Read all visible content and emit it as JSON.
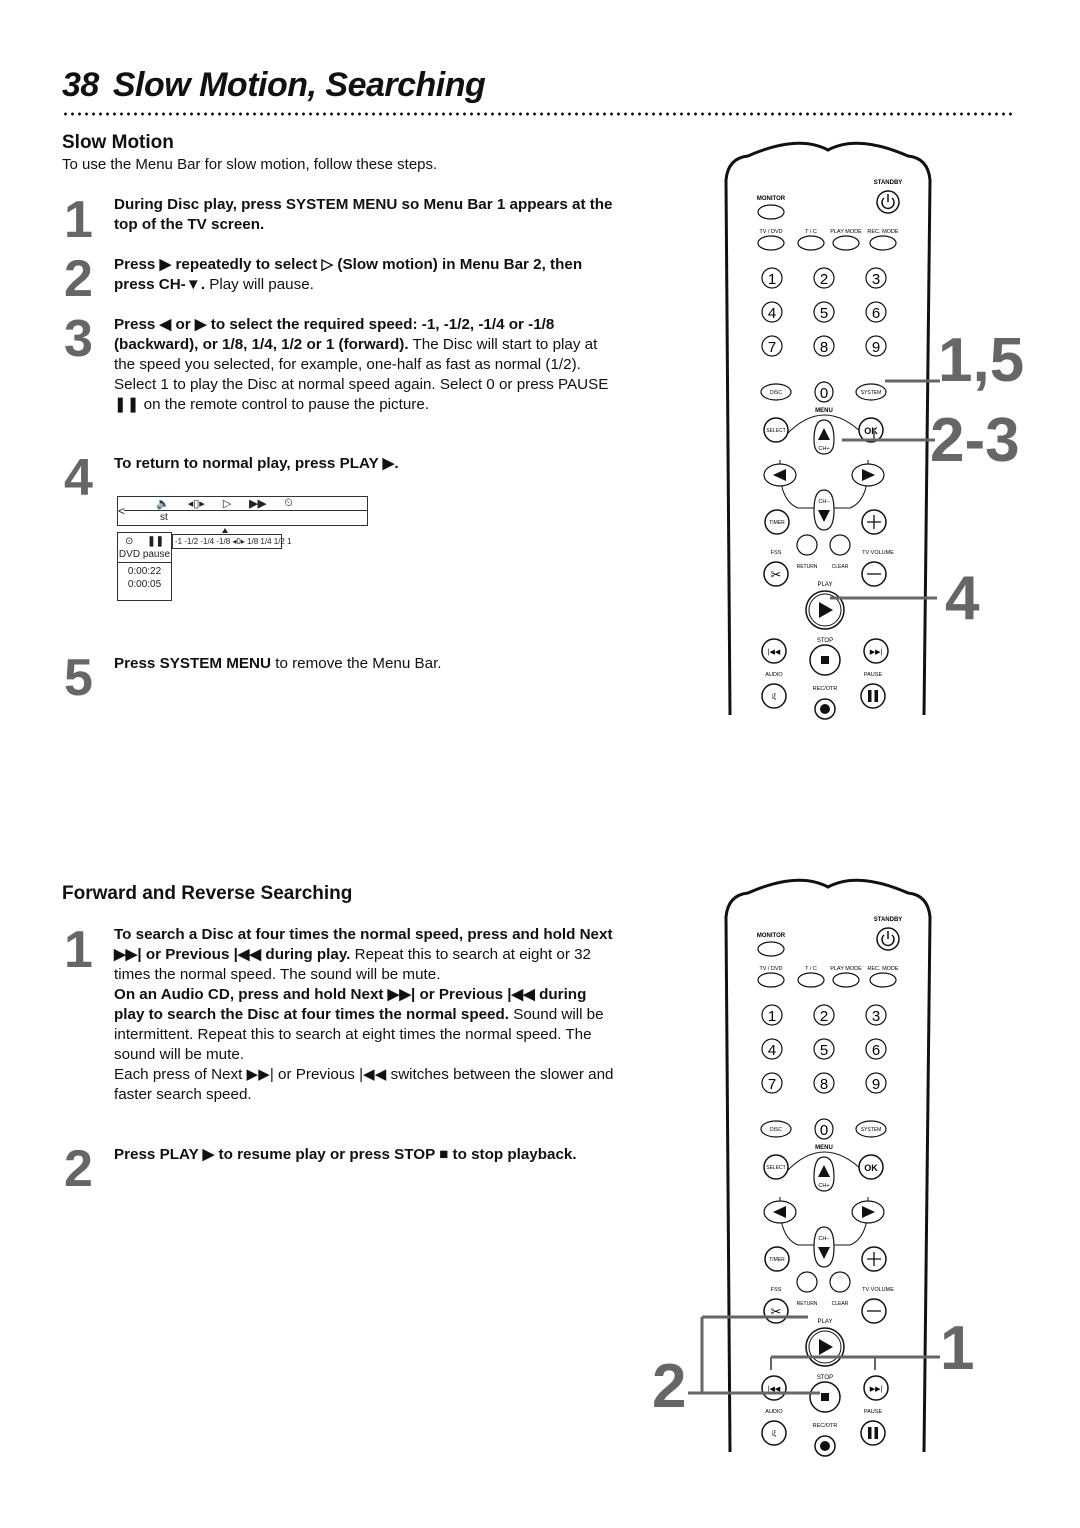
{
  "page": {
    "number": "38",
    "title": "Slow Motion, Searching"
  },
  "slow_motion": {
    "heading": "Slow Motion",
    "intro": "To use the Menu Bar for slow motion, follow these steps.",
    "steps": [
      {
        "num": "1",
        "bold": "During Disc play, press SYSTEM MENU so Menu Bar 1 appears at the top of the TV screen.",
        "normal": ""
      },
      {
        "num": "2",
        "bold": "Press ▶ repeatedly to select ▷ (Slow motion) in Menu Bar 2, then press CH-▼.",
        "normal": " Play will pause."
      },
      {
        "num": "3",
        "bold": "Press ◀ or ▶ to select the required speed: -1, -1/2, -1/4 or -1/8 (backward), or 1/8, 1/4, 1/2 or 1 (forward).",
        "normal": " The Disc will start to play at the speed you selected, for example, one-half as fast as normal (1/2).",
        "extra": "Select 1 to play the Disc at normal speed again. Select 0 or press PAUSE ❚❚ on the remote control to pause the picture."
      },
      {
        "num": "4",
        "bold": "To return to normal play, press PLAY ▶.",
        "normal": ""
      },
      {
        "num": "5",
        "bold": "Press SYSTEM MENU",
        "normal": " to remove the Menu Bar."
      }
    ],
    "osd": {
      "back_arrow": "<",
      "menu_icons": [
        "audio-icon",
        "frame-step-icon",
        "slow-motion-icon",
        "fast-forward-icon",
        "time-search-icon"
      ],
      "menu_icon_glyphs": [
        "🔈",
        "◂▯▸",
        "▷",
        "▶▶",
        "⏲"
      ],
      "sub_label": "st",
      "status_icons": [
        "disc-icon",
        "pause-icon"
      ],
      "status_glyphs": [
        "⊙",
        "❚❚"
      ],
      "status_text": "DVD pause",
      "time_1": "0:00:22",
      "time_2": "0:00:05",
      "speed_scale": "-1 -1/2 -1/4 -1/8 ◂0▸ 1/8  1/4  1/2  1",
      "selected_speed": "0"
    }
  },
  "searching": {
    "heading": "Forward and Reverse Searching",
    "steps": [
      {
        "num": "1",
        "bold": "To search a Disc at four times the normal speed, press and hold Next ▶▶| or Previous |◀◀ during play.",
        "normal": " Repeat this to search at eight or 32 times the normal speed. The sound will be mute.",
        "bold2": "On an Audio CD, press and hold Next ▶▶| or Previous |◀◀ during play to search the Disc at four times the normal speed.",
        "normal2": " Sound will be intermittent. Repeat this to search at eight times the normal speed.  The sound will be mute.",
        "extra": "Each press of Next ▶▶| or Previous |◀◀ switches between the slower and faster search speed."
      },
      {
        "num": "2",
        "bold": "Press PLAY ▶ to resume play or press STOP ■ to stop playback.",
        "normal": ""
      }
    ]
  },
  "remote": {
    "labels": {
      "standby": "STANDBY",
      "monitor": "MONITOR",
      "tv_dvd": "TV / DVD",
      "tc": "T / C",
      "play_mode": "PLAY MODE",
      "rec_mode": "REC. MODE",
      "disc": "DISC",
      "zero": "0",
      "system": "SYSTEM",
      "menu": "MENU",
      "select": "SELECT",
      "ok": "OK",
      "ch_plus": "CH+",
      "ch_minus": "CH−",
      "timer": "TIMER",
      "fss": "FSS",
      "return": "RETURN",
      "clear": "CLEAR",
      "tv_volume": "TV VOLUME",
      "play": "PLAY",
      "stop": "STOP",
      "audio": "AUDIO",
      "pause": "PAUSE",
      "rec_otr": "REC/OTR"
    },
    "digits": [
      "1",
      "2",
      "3",
      "4",
      "5",
      "6",
      "7",
      "8",
      "9"
    ]
  },
  "callouts": {
    "top": [
      "1,5",
      "2-3",
      "4"
    ],
    "bottom": [
      "1",
      "2"
    ]
  }
}
